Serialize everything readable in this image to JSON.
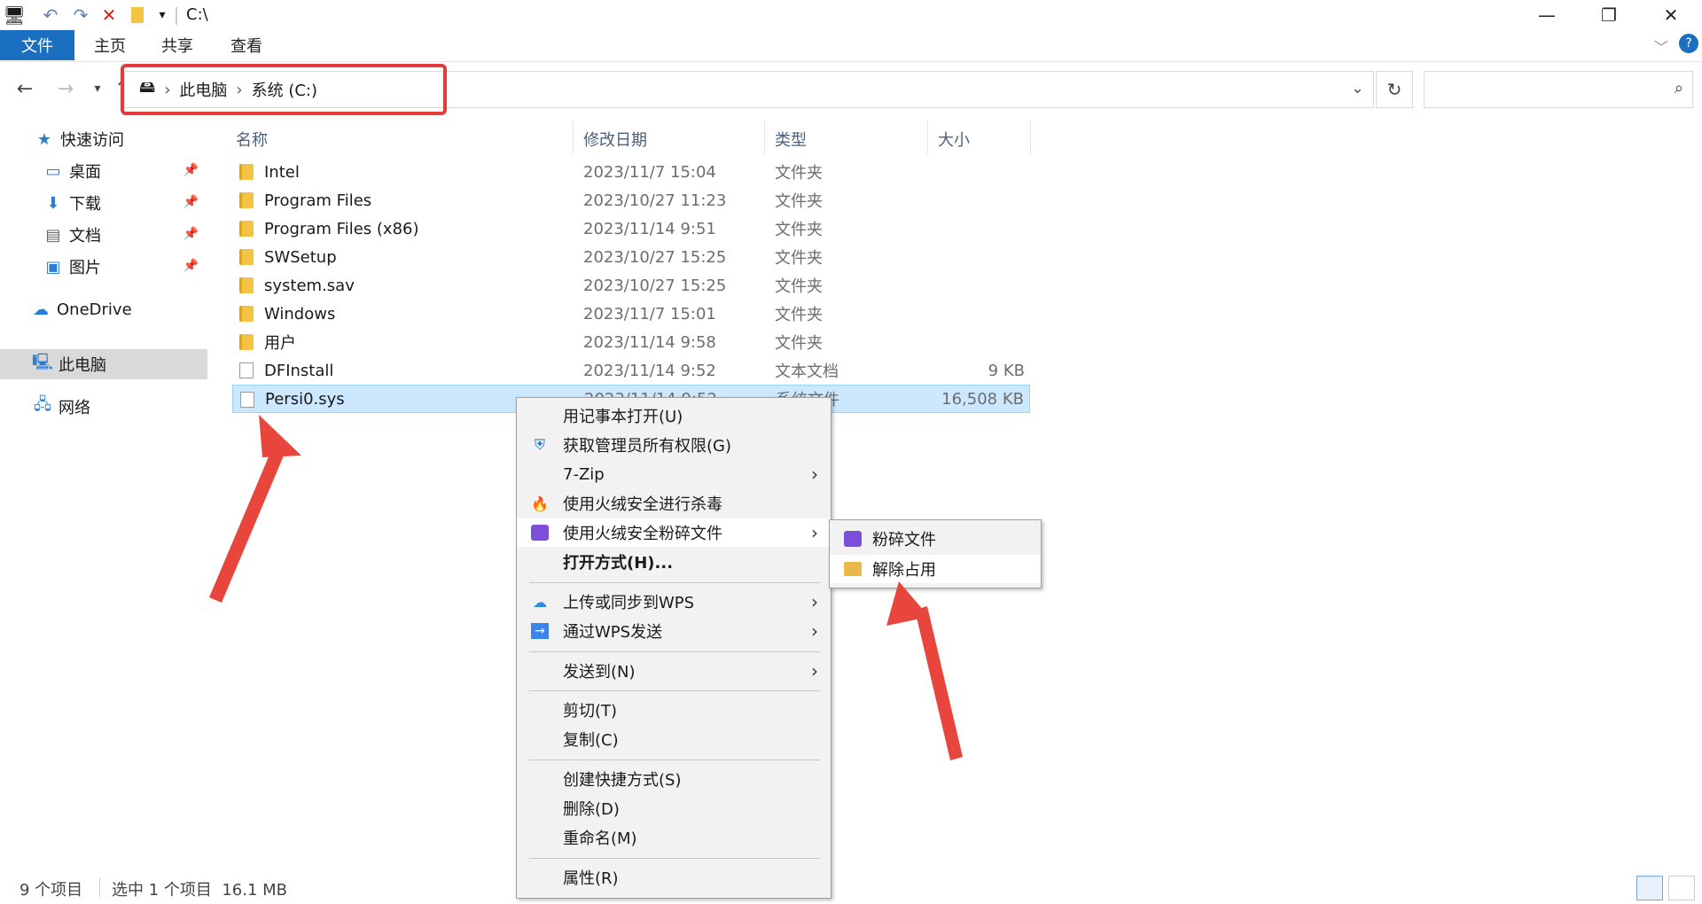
{
  "titlebar": {
    "path": "C:\\",
    "minimize": "—",
    "restore": "❐",
    "close": "✕"
  },
  "ribbon": {
    "tabs": [
      {
        "label": "文件"
      },
      {
        "label": "主页"
      },
      {
        "label": "共享"
      },
      {
        "label": "查看"
      }
    ]
  },
  "address": {
    "crumbs": [
      "此电脑",
      "系统 (C:)"
    ]
  },
  "sidebar": {
    "items": [
      {
        "label": "快速访问",
        "icon": "star-icon"
      },
      {
        "label": "桌面",
        "icon": "desktop-icon"
      },
      {
        "label": "下载",
        "icon": "download-icon"
      },
      {
        "label": "文档",
        "icon": "document-icon"
      },
      {
        "label": "图片",
        "icon": "picture-icon"
      },
      {
        "label": "OneDrive",
        "icon": "cloud-icon"
      },
      {
        "label": "此电脑",
        "icon": "computer-icon"
      },
      {
        "label": "网络",
        "icon": "network-icon"
      }
    ]
  },
  "columns": {
    "name": "名称",
    "date": "修改日期",
    "type": "类型",
    "size": "大小"
  },
  "files": [
    {
      "name": "Intel",
      "date": "2023/11/7 15:04",
      "type": "文件夹",
      "size": ""
    },
    {
      "name": "Program Files",
      "date": "2023/10/27 11:23",
      "type": "文件夹",
      "size": ""
    },
    {
      "name": "Program Files (x86)",
      "date": "2023/11/14 9:51",
      "type": "文件夹",
      "size": ""
    },
    {
      "name": "SWSetup",
      "date": "2023/10/27 15:25",
      "type": "文件夹",
      "size": ""
    },
    {
      "name": "system.sav",
      "date": "2023/10/27 15:25",
      "type": "文件夹",
      "size": ""
    },
    {
      "name": "Windows",
      "date": "2023/11/7 15:01",
      "type": "文件夹",
      "size": ""
    },
    {
      "name": "用户",
      "date": "2023/11/14 9:58",
      "type": "文件夹",
      "size": ""
    },
    {
      "name": "DFInstall",
      "date": "2023/11/14 9:52",
      "type": "文本文档",
      "size": "9 KB"
    },
    {
      "name": "Persi0.sys",
      "date": "2023/11/14 9:52",
      "type": "系统文件",
      "size": "16,508 KB"
    }
  ],
  "context_menu": {
    "items": [
      "用记事本打开(U)",
      "获取管理员所有权限(G)",
      "7-Zip",
      "使用火绒安全进行杀毒",
      "使用火绒安全粉碎文件",
      "打开方式(H)...",
      "上传或同步到WPS",
      "通过WPS发送",
      "发送到(N)",
      "剪切(T)",
      "复制(C)",
      "创建快捷方式(S)",
      "删除(D)",
      "重命名(M)",
      "属性(R)"
    ]
  },
  "submenu": {
    "items": [
      "粉碎文件",
      "解除占用"
    ]
  },
  "status": {
    "count": "9 个项目",
    "selection": "选中 1 个项目  16.1 MB"
  },
  "colors": {
    "accent": "#1a6fc0",
    "selection": "#cce8ff",
    "highlight_red": "#e23b3b"
  }
}
